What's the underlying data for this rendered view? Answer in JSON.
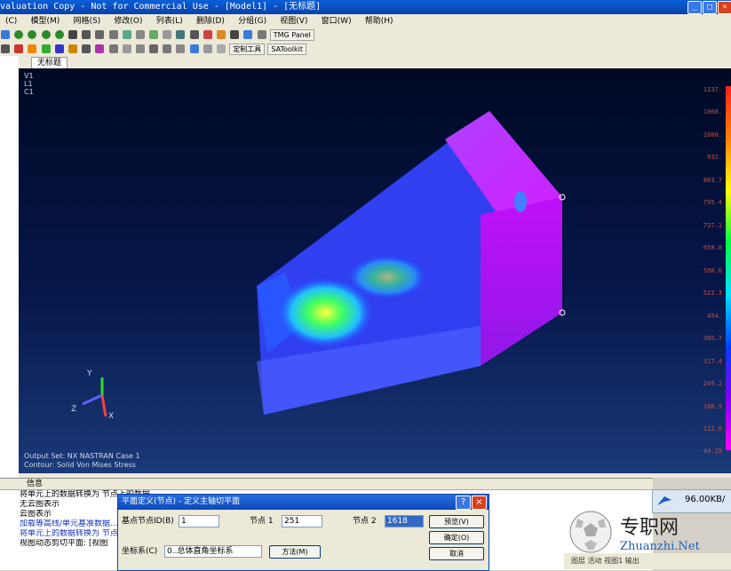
{
  "window": {
    "title": "valuation Copy - Not for Commercial Use - [Model1] - [无标题]"
  },
  "menu": [
    "(C)",
    "模型(M)",
    "网格(S)",
    "修改(O)",
    "列表(L)",
    "删除(D)",
    "分组(G)",
    "视图(V)",
    "窗口(W)",
    "帮助(H)"
  ],
  "toolbar": {
    "tmg_label": "TMG Panel",
    "custom_tools_label": "定制工具",
    "satoolkit_label": "SAToolkit"
  },
  "tab": {
    "label": "无标题"
  },
  "viewport": {
    "corner_labels": [
      "V1",
      "L1",
      "C1"
    ],
    "output_set": "Output Set: NX NASTRAN Case 1",
    "contour": "Contour: Solid Von Mises Stress",
    "axis_labels": {
      "x": "X",
      "y": "Y",
      "z": "Z"
    },
    "legend": [
      "1137.",
      "1068.",
      "1000.",
      "932.",
      "863.7",
      "795.4",
      "727.1",
      "658.8",
      "590.6",
      "522.3",
      "454.",
      "385.7",
      "317.4",
      "249.2",
      "180.9",
      "112.6",
      "44.25"
    ]
  },
  "info": {
    "header": "信息",
    "lines": [
      "将单元上的数据转换为 节点上的数据...",
      "无云图表示",
      "云图表示",
      "加载等高线/单元基准数据...",
      "将单元上的数据转换为 节点上的数据",
      "视图动态剪切平面: [视图"
    ]
  },
  "dialog": {
    "title": "平面定义(节点) - 定义主轴切平面",
    "base_node_label": "基点节点ID(B)",
    "base_node_value": "1",
    "node1_label": "节点 1",
    "node1_value": "251",
    "node2_label": "节点 2",
    "node2_value": "1618",
    "coord_label": "坐标系(C)",
    "coord_value": "0..总体直角坐标系",
    "method_button": "方法(M)",
    "preview_button": "预览(V)",
    "ok_button": "确定(O)",
    "cancel_button": "取消"
  },
  "network": {
    "speed": "96.00KB/"
  },
  "watermark": {
    "cn": "专职网",
    "url": "Zhuanzhi.Net"
  },
  "status": {
    "text": "图层  活动  视图1  输出"
  }
}
